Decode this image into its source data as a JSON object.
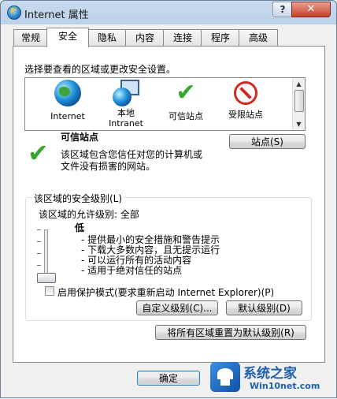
{
  "window": {
    "title": "Internet 属性",
    "help_label": "?",
    "close_label": "✕"
  },
  "tabs": [
    {
      "label": "常规"
    },
    {
      "label": "安全"
    },
    {
      "label": "隐私"
    },
    {
      "label": "内容"
    },
    {
      "label": "连接"
    },
    {
      "label": "程序"
    },
    {
      "label": "高级"
    }
  ],
  "active_tab": "安全",
  "security": {
    "instruction": "选择要查看的区域或更改安全设置。",
    "zones": [
      {
        "label": "Internet",
        "icon": "globe-icon"
      },
      {
        "label": "本地\nIntranet",
        "icon": "local-intranet-icon"
      },
      {
        "label": "可信站点",
        "icon": "check-icon"
      },
      {
        "label": "受限站点",
        "icon": "restricted-icon"
      }
    ],
    "selected_zone": {
      "name": "可信站点",
      "description_line1": "该区域包含您信任对您的计算机或",
      "description_line2": "文件没有损害的网站。",
      "sites_button": "站点(S)"
    },
    "level_group": {
      "title": "该区域的安全级别(L)",
      "allowed_levels": "该区域的允许级别: 全部",
      "level_name": "低",
      "bullets": [
        "- 提供最小的安全措施和警告提示",
        "- 下载大多数内容，且无提示运行",
        "- 可以运行所有的活动内容",
        "- 适用于绝对信任的站点"
      ],
      "protected_mode_label": "启用保护模式(要求重新启动 Internet Explorer)(P)",
      "protected_mode_checked": false,
      "custom_level_button": "自定义级别(C)...",
      "default_level_button": "默认级别(D)"
    },
    "reset_all_button": "将所有区域重置为默认级别(R)"
  },
  "footer": {
    "ok_button": "确定"
  },
  "watermark": {
    "title": "系统之家",
    "url": "Win10net.com"
  }
}
